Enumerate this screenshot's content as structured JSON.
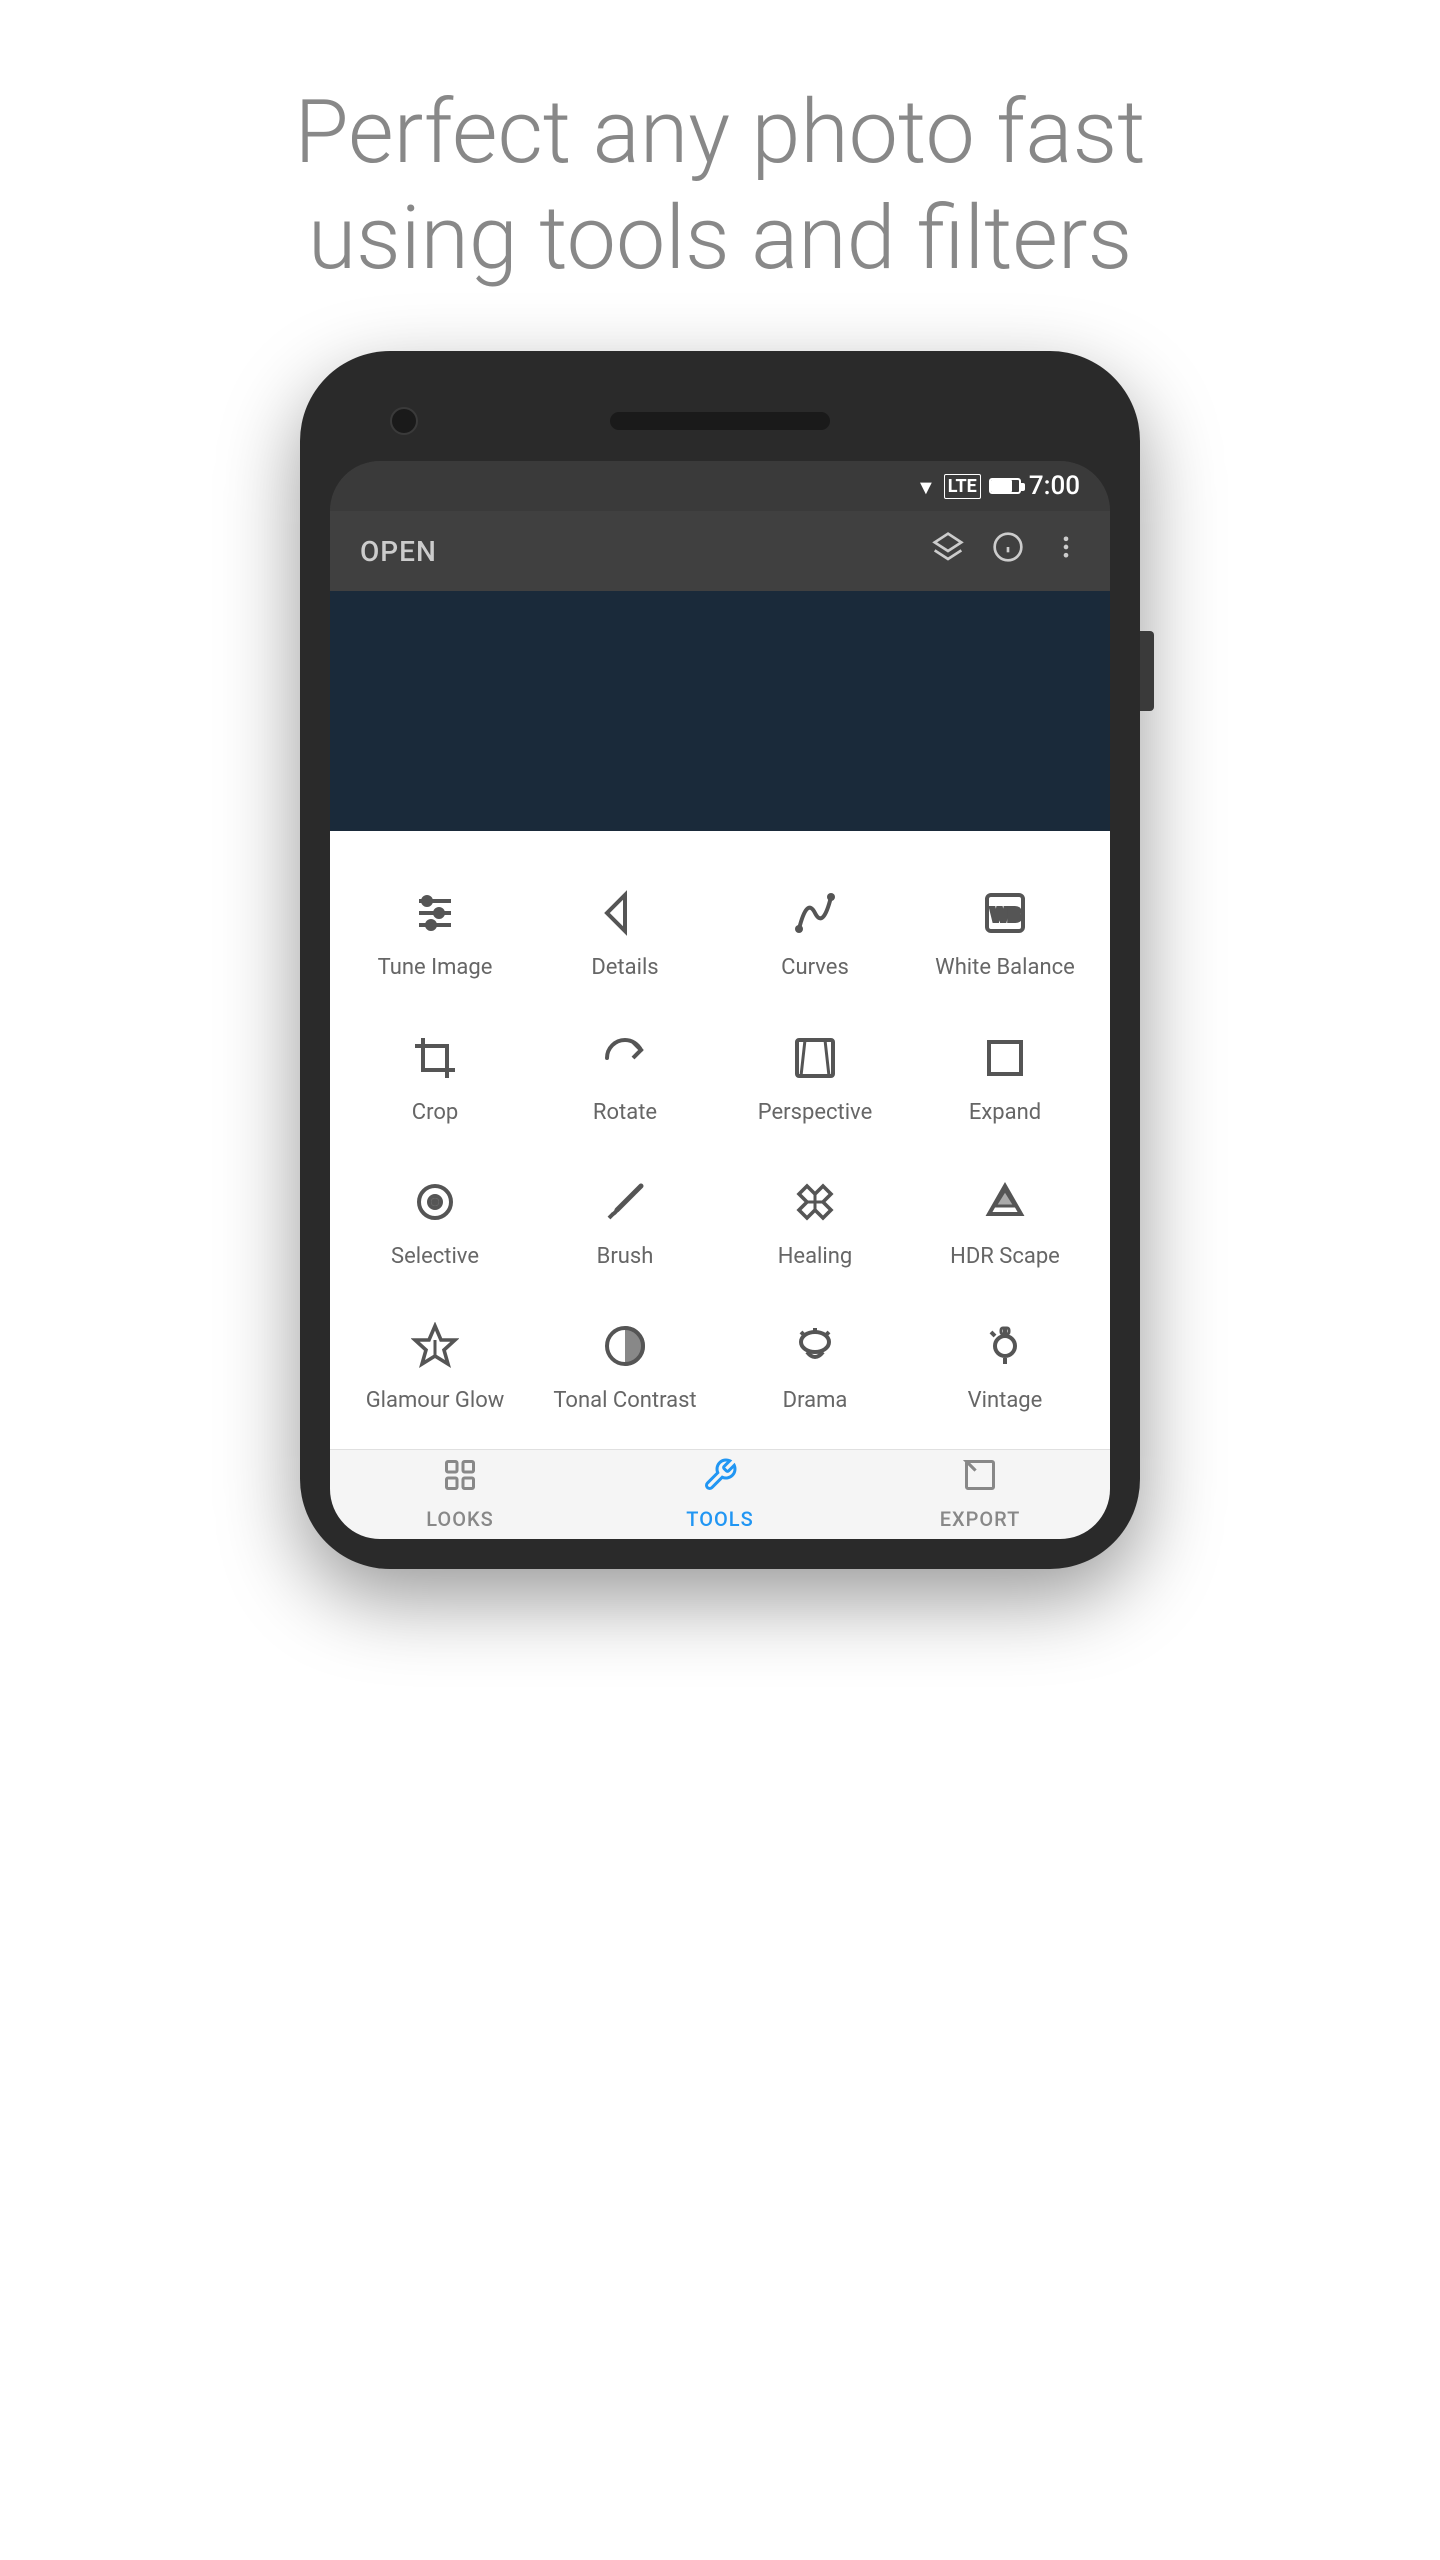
{
  "header": {
    "line1": "Perfect any photo fast",
    "line2": "using tools and filters"
  },
  "statusBar": {
    "time": "7:00",
    "lteBadge": "LTE"
  },
  "toolbar": {
    "openLabel": "OPEN",
    "icons": [
      "layers",
      "info",
      "more"
    ]
  },
  "tools": [
    {
      "id": "tune-image",
      "label": "Tune Image"
    },
    {
      "id": "details",
      "label": "Details"
    },
    {
      "id": "curves",
      "label": "Curves"
    },
    {
      "id": "white-balance",
      "label": "White Balance"
    },
    {
      "id": "crop",
      "label": "Crop"
    },
    {
      "id": "rotate",
      "label": "Rotate"
    },
    {
      "id": "perspective",
      "label": "Perspective"
    },
    {
      "id": "expand",
      "label": "Expand"
    },
    {
      "id": "selective",
      "label": "Selective"
    },
    {
      "id": "brush",
      "label": "Brush"
    },
    {
      "id": "healing",
      "label": "Healing"
    },
    {
      "id": "hdr-scape",
      "label": "HDR Scape"
    },
    {
      "id": "glamour-glow",
      "label": "Glamour Glow"
    },
    {
      "id": "tonal-contrast",
      "label": "Tonal Contrast"
    },
    {
      "id": "drama",
      "label": "Drama"
    },
    {
      "id": "vintage",
      "label": "Vintage"
    }
  ],
  "bottomNav": [
    {
      "id": "looks",
      "label": "LOOKS",
      "active": false
    },
    {
      "id": "tools",
      "label": "TOOLS",
      "active": true
    },
    {
      "id": "export",
      "label": "EXPORT",
      "active": false
    }
  ]
}
